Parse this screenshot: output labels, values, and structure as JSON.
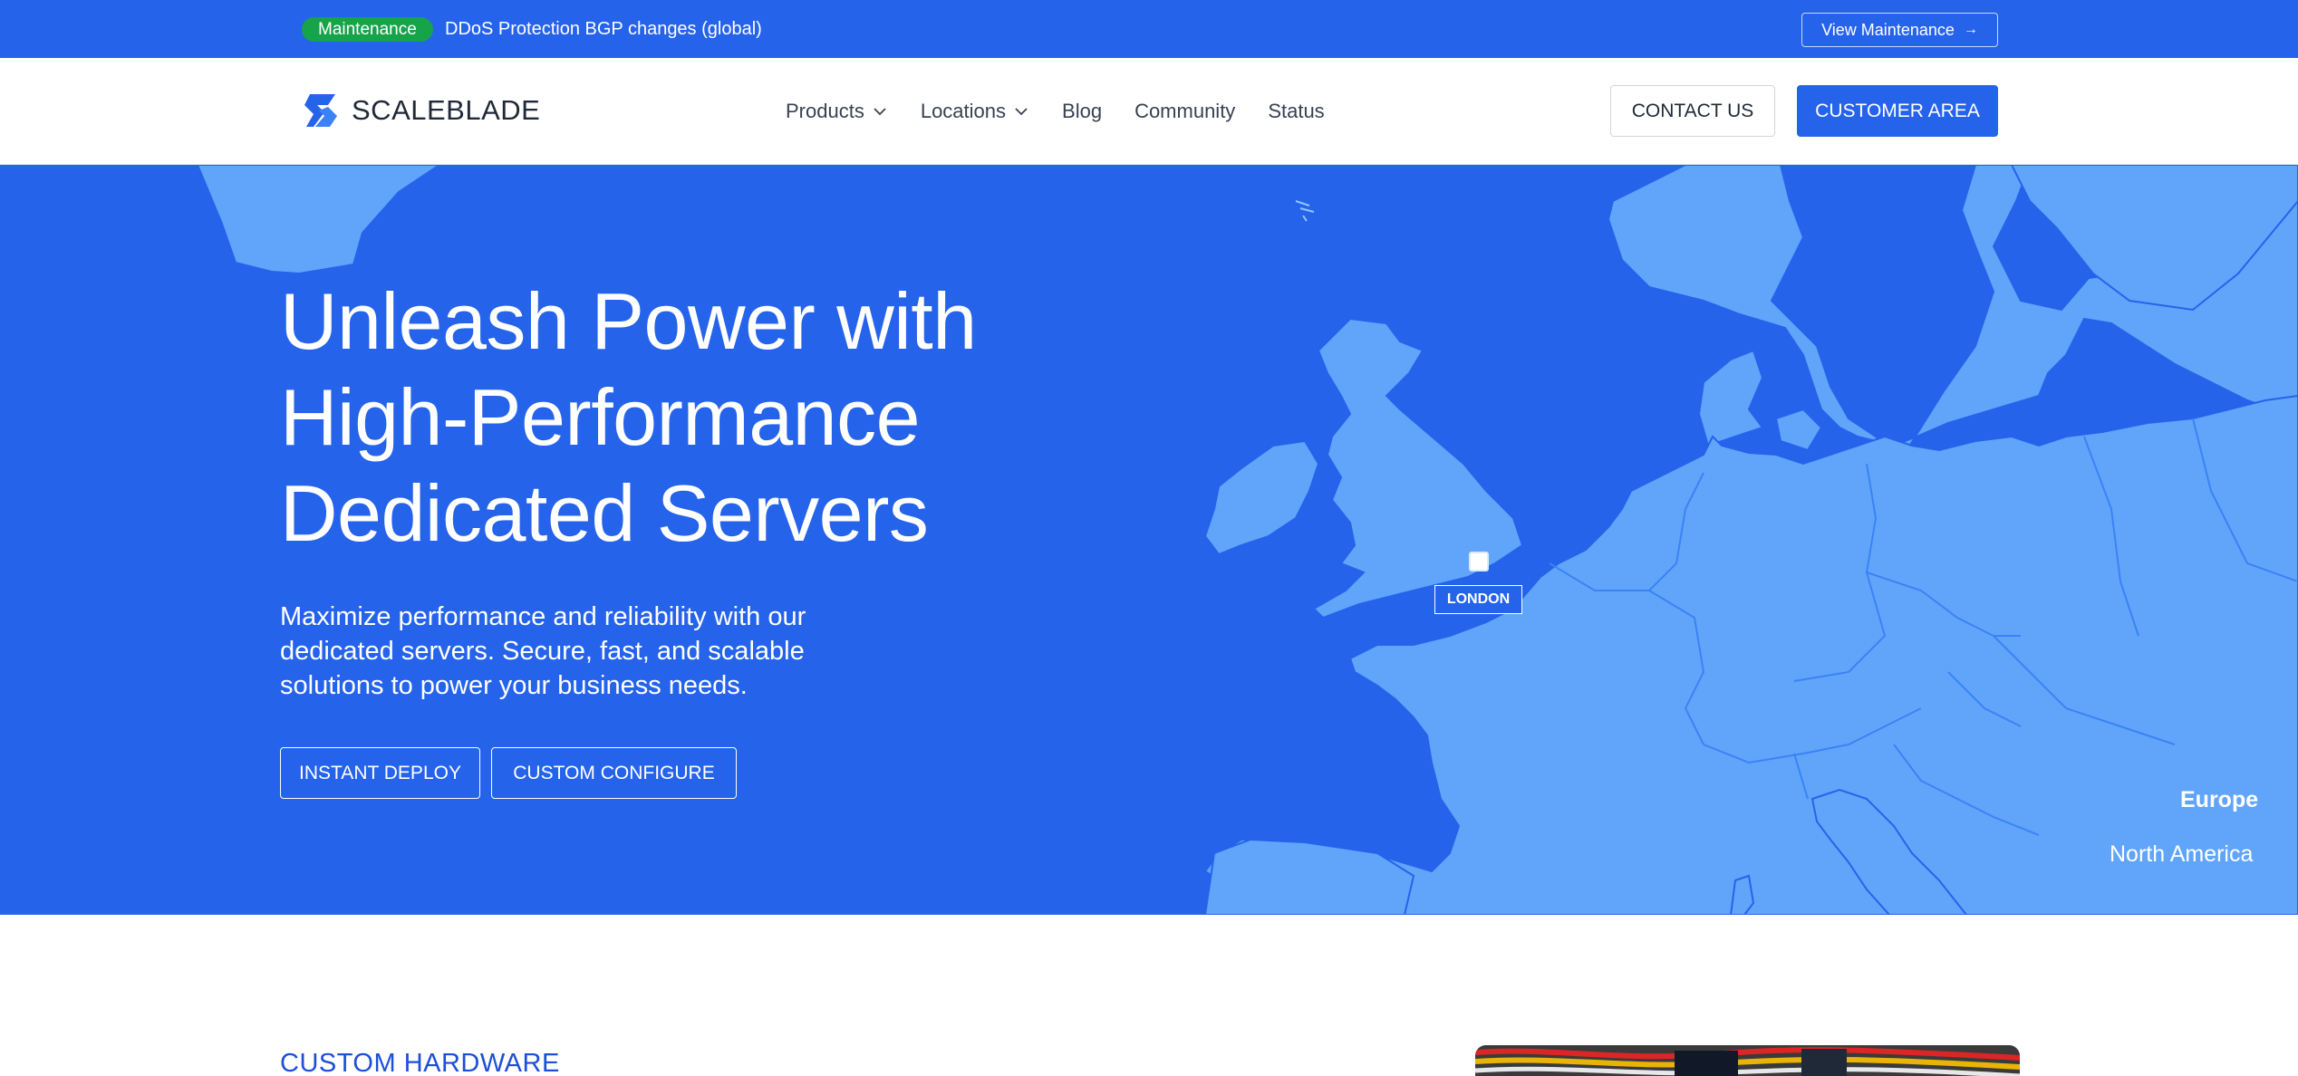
{
  "topbar": {
    "badge": "Maintenance",
    "announcement": "DDoS Protection BGP changes (global)",
    "view_button": "View Maintenance",
    "view_icon": "arrow-right-icon"
  },
  "header": {
    "logo_text": "SCALEBLADE",
    "nav": [
      {
        "label": "Products",
        "has_dropdown": true
      },
      {
        "label": "Locations",
        "has_dropdown": true
      },
      {
        "label": "Blog",
        "has_dropdown": false
      },
      {
        "label": "Community",
        "has_dropdown": false
      },
      {
        "label": "Status",
        "has_dropdown": false
      }
    ],
    "contact_button": "CONTACT US",
    "customer_button": "CUSTOMER AREA"
  },
  "hero": {
    "title_lines": [
      "Unleash Power with",
      "High-Performance",
      "Dedicated Servers"
    ],
    "subtitle": "Maximize performance and reliability with our dedicated servers. Secure, fast, and scalable solutions to power your business needs.",
    "deploy_button": "INSTANT DEPLOY",
    "configure_button": "CUSTOM CONFIGURE",
    "map": {
      "marker_label": "LONDON",
      "regions": [
        "Europe",
        "North America"
      ],
      "active_region": "Europe"
    }
  },
  "section": {
    "label": "CUSTOM HARDWARE"
  },
  "colors": {
    "brand_blue": "#2563eb",
    "land_blue": "#60a5fa",
    "maintenance_green": "#16a34a",
    "section_label_blue": "#1d4ed8"
  }
}
